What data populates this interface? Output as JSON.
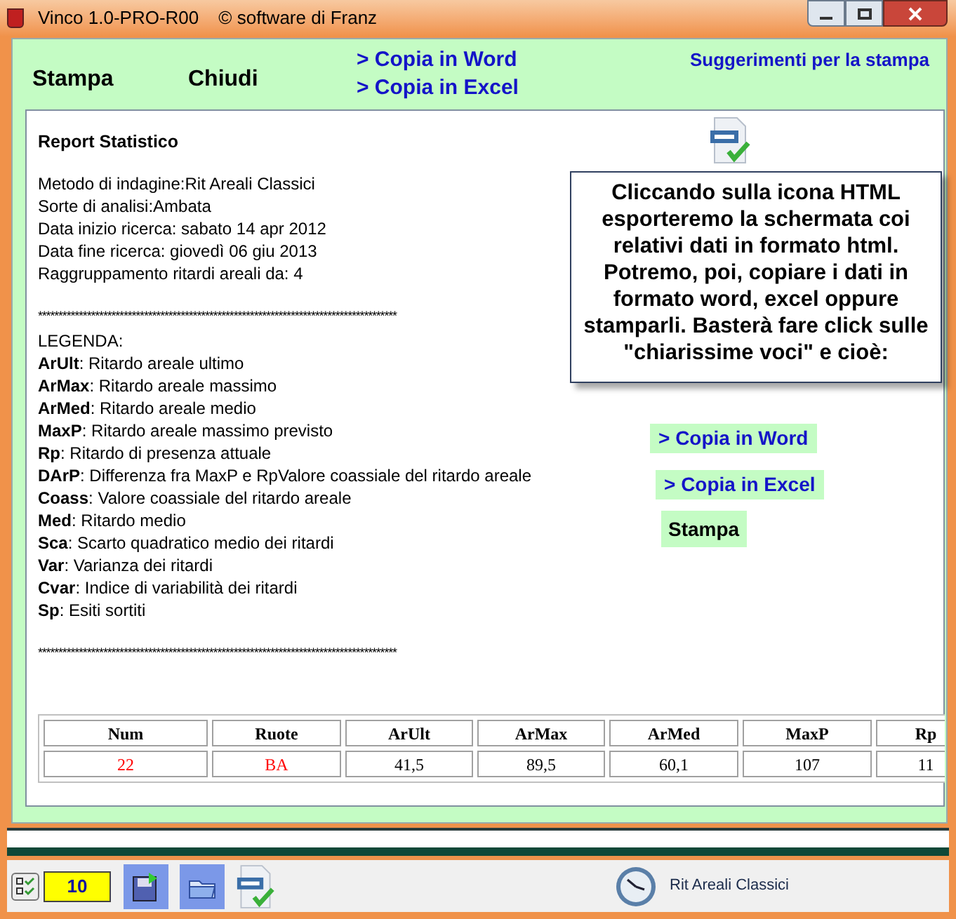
{
  "window": {
    "title": "Vinco 1.0-PRO-R00",
    "copyright": "© software di Franz"
  },
  "toolbar": {
    "print": "Stampa",
    "close": "Chiudi",
    "links": [
      "> Copia in Word",
      "> Copia in Excel"
    ],
    "tips": "Suggerimenti per la stampa"
  },
  "report": {
    "title": "Report Statistico",
    "info": [
      "Metodo di indagine:Rit Areali Classici",
      "Sorte di analisi:Ambata",
      "Data inizio ricerca: sabato 14 apr 2012",
      "Data fine ricerca: giovedì 06 giu 2013",
      "Raggruppamento ritardi areali da: 4"
    ],
    "separator": "****************************************************************************************",
    "legend_title": "LEGENDA:",
    "legend": [
      "**ArUlt**: Ritardo areale ultimo",
      "**ArMax**: Ritardo areale massimo",
      "**ArMed**: Ritardo areale medio",
      "**MaxP**: Ritardo areale massimo previsto",
      "**Rp**: Ritardo di presenza attuale",
      "**DArP**: Differenza fra MaxP e RpValore coassiale del ritardo areale",
      "**Coass**: Valore coassiale del ritardo areale",
      "**Med**: Ritardo medio",
      "**Sca**: Scarto quadratico medio dei ritardi",
      "**Var**: Varianza dei ritardi",
      "**Cvar**: Indice di variabilità dei ritardi",
      "**Sp**: Esiti sortiti"
    ],
    "separator_2": "****************************************************************************************"
  },
  "tooltip": "Cliccando sulla icona HTML esporteremo la schermata coi relativi dati in formato html. Potremo, poi, copiare i dati in formato word, excel oppure stamparli. Basterà fare click sulle \"chiarissime voci\" e cioè:",
  "demo_links": [
    "> Copia in Word",
    "> Copia in Excel"
  ],
  "demo_print": "Stampa",
  "table": {
    "columns": [
      "Num",
      "Ruote",
      "ArUlt",
      "ArMax",
      "ArMed",
      "MaxP",
      "Rp"
    ],
    "rows": [
      [
        {
          "text": "22",
          "color": "#ff0000"
        },
        {
          "text": "BA",
          "color": "#ff0000"
        },
        {
          "text": "41,5",
          "color": "#000000"
        },
        {
          "text": "89,5",
          "color": "#000000"
        },
        {
          "text": "60,1",
          "color": "#000000"
        },
        {
          "text": "107",
          "color": "#000000"
        },
        {
          "text": "11",
          "color": "#000000"
        }
      ]
    ]
  },
  "status_bar": {
    "count": "10",
    "method": "Rit Areali Classici"
  }
}
